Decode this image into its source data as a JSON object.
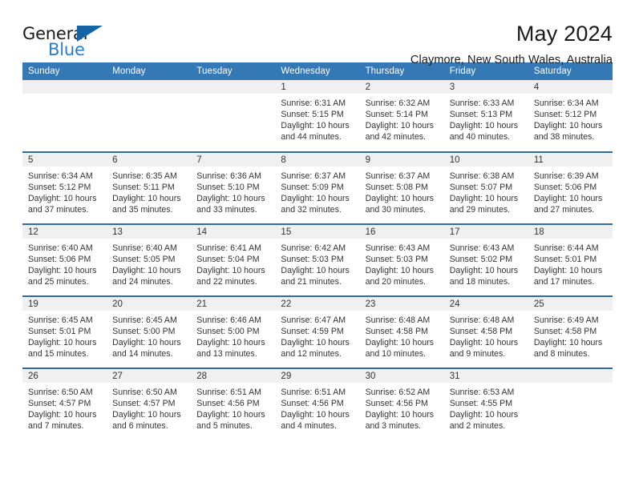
{
  "brand": {
    "name_top": "General",
    "name_bottom": "Blue",
    "accent_color": "#2b7cc4",
    "triangle_color": "#1464a5"
  },
  "header": {
    "title": "May 2024",
    "subtitle": "Claymore, New South Wales, Australia"
  },
  "theme": {
    "header_bg": "#3479b5",
    "row_divider": "#2e6da4",
    "daynum_bg": "#f0f0f0",
    "text": "#333333"
  },
  "calendar": {
    "weekday_headers": [
      "Sunday",
      "Monday",
      "Tuesday",
      "Wednesday",
      "Thursday",
      "Friday",
      "Saturday"
    ],
    "weeks": [
      [
        {
          "day": "",
          "lines": []
        },
        {
          "day": "",
          "lines": []
        },
        {
          "day": "",
          "lines": []
        },
        {
          "day": "1",
          "lines": [
            "Sunrise: 6:31 AM",
            "Sunset: 5:15 PM",
            "Daylight: 10 hours",
            "and 44 minutes."
          ]
        },
        {
          "day": "2",
          "lines": [
            "Sunrise: 6:32 AM",
            "Sunset: 5:14 PM",
            "Daylight: 10 hours",
            "and 42 minutes."
          ]
        },
        {
          "day": "3",
          "lines": [
            "Sunrise: 6:33 AM",
            "Sunset: 5:13 PM",
            "Daylight: 10 hours",
            "and 40 minutes."
          ]
        },
        {
          "day": "4",
          "lines": [
            "Sunrise: 6:34 AM",
            "Sunset: 5:12 PM",
            "Daylight: 10 hours",
            "and 38 minutes."
          ]
        }
      ],
      [
        {
          "day": "5",
          "lines": [
            "Sunrise: 6:34 AM",
            "Sunset: 5:12 PM",
            "Daylight: 10 hours",
            "and 37 minutes."
          ]
        },
        {
          "day": "6",
          "lines": [
            "Sunrise: 6:35 AM",
            "Sunset: 5:11 PM",
            "Daylight: 10 hours",
            "and 35 minutes."
          ]
        },
        {
          "day": "7",
          "lines": [
            "Sunrise: 6:36 AM",
            "Sunset: 5:10 PM",
            "Daylight: 10 hours",
            "and 33 minutes."
          ]
        },
        {
          "day": "8",
          "lines": [
            "Sunrise: 6:37 AM",
            "Sunset: 5:09 PM",
            "Daylight: 10 hours",
            "and 32 minutes."
          ]
        },
        {
          "day": "9",
          "lines": [
            "Sunrise: 6:37 AM",
            "Sunset: 5:08 PM",
            "Daylight: 10 hours",
            "and 30 minutes."
          ]
        },
        {
          "day": "10",
          "lines": [
            "Sunrise: 6:38 AM",
            "Sunset: 5:07 PM",
            "Daylight: 10 hours",
            "and 29 minutes."
          ]
        },
        {
          "day": "11",
          "lines": [
            "Sunrise: 6:39 AM",
            "Sunset: 5:06 PM",
            "Daylight: 10 hours",
            "and 27 minutes."
          ]
        }
      ],
      [
        {
          "day": "12",
          "lines": [
            "Sunrise: 6:40 AM",
            "Sunset: 5:06 PM",
            "Daylight: 10 hours",
            "and 25 minutes."
          ]
        },
        {
          "day": "13",
          "lines": [
            "Sunrise: 6:40 AM",
            "Sunset: 5:05 PM",
            "Daylight: 10 hours",
            "and 24 minutes."
          ]
        },
        {
          "day": "14",
          "lines": [
            "Sunrise: 6:41 AM",
            "Sunset: 5:04 PM",
            "Daylight: 10 hours",
            "and 22 minutes."
          ]
        },
        {
          "day": "15",
          "lines": [
            "Sunrise: 6:42 AM",
            "Sunset: 5:03 PM",
            "Daylight: 10 hours",
            "and 21 minutes."
          ]
        },
        {
          "day": "16",
          "lines": [
            "Sunrise: 6:43 AM",
            "Sunset: 5:03 PM",
            "Daylight: 10 hours",
            "and 20 minutes."
          ]
        },
        {
          "day": "17",
          "lines": [
            "Sunrise: 6:43 AM",
            "Sunset: 5:02 PM",
            "Daylight: 10 hours",
            "and 18 minutes."
          ]
        },
        {
          "day": "18",
          "lines": [
            "Sunrise: 6:44 AM",
            "Sunset: 5:01 PM",
            "Daylight: 10 hours",
            "and 17 minutes."
          ]
        }
      ],
      [
        {
          "day": "19",
          "lines": [
            "Sunrise: 6:45 AM",
            "Sunset: 5:01 PM",
            "Daylight: 10 hours",
            "and 15 minutes."
          ]
        },
        {
          "day": "20",
          "lines": [
            "Sunrise: 6:45 AM",
            "Sunset: 5:00 PM",
            "Daylight: 10 hours",
            "and 14 minutes."
          ]
        },
        {
          "day": "21",
          "lines": [
            "Sunrise: 6:46 AM",
            "Sunset: 5:00 PM",
            "Daylight: 10 hours",
            "and 13 minutes."
          ]
        },
        {
          "day": "22",
          "lines": [
            "Sunrise: 6:47 AM",
            "Sunset: 4:59 PM",
            "Daylight: 10 hours",
            "and 12 minutes."
          ]
        },
        {
          "day": "23",
          "lines": [
            "Sunrise: 6:48 AM",
            "Sunset: 4:58 PM",
            "Daylight: 10 hours",
            "and 10 minutes."
          ]
        },
        {
          "day": "24",
          "lines": [
            "Sunrise: 6:48 AM",
            "Sunset: 4:58 PM",
            "Daylight: 10 hours",
            "and 9 minutes."
          ]
        },
        {
          "day": "25",
          "lines": [
            "Sunrise: 6:49 AM",
            "Sunset: 4:58 PM",
            "Daylight: 10 hours",
            "and 8 minutes."
          ]
        }
      ],
      [
        {
          "day": "26",
          "lines": [
            "Sunrise: 6:50 AM",
            "Sunset: 4:57 PM",
            "Daylight: 10 hours",
            "and 7 minutes."
          ]
        },
        {
          "day": "27",
          "lines": [
            "Sunrise: 6:50 AM",
            "Sunset: 4:57 PM",
            "Daylight: 10 hours",
            "and 6 minutes."
          ]
        },
        {
          "day": "28",
          "lines": [
            "Sunrise: 6:51 AM",
            "Sunset: 4:56 PM",
            "Daylight: 10 hours",
            "and 5 minutes."
          ]
        },
        {
          "day": "29",
          "lines": [
            "Sunrise: 6:51 AM",
            "Sunset: 4:56 PM",
            "Daylight: 10 hours",
            "and 4 minutes."
          ]
        },
        {
          "day": "30",
          "lines": [
            "Sunrise: 6:52 AM",
            "Sunset: 4:56 PM",
            "Daylight: 10 hours",
            "and 3 minutes."
          ]
        },
        {
          "day": "31",
          "lines": [
            "Sunrise: 6:53 AM",
            "Sunset: 4:55 PM",
            "Daylight: 10 hours",
            "and 2 minutes."
          ]
        },
        {
          "day": "",
          "lines": []
        }
      ]
    ]
  }
}
